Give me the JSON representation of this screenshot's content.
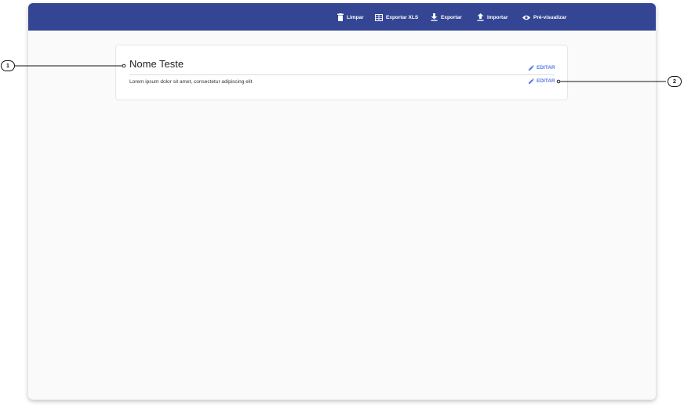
{
  "toolbar": {
    "buttons": [
      {
        "label": "Limpar",
        "icon": "trash-icon"
      },
      {
        "label": "Exportar XLS",
        "icon": "excel-icon"
      },
      {
        "label": "Exportar",
        "icon": "download-icon"
      },
      {
        "label": "Importar",
        "icon": "upload-icon"
      },
      {
        "label": "Pré-visualizar",
        "icon": "eye-icon"
      }
    ],
    "background": "#334593"
  },
  "card": {
    "title": "Nome Teste",
    "description": "Lorem ipsum dolor sit amet, consectetur adipiscing elit",
    "edit_label": "EDITAR",
    "accent": "#5a7be8"
  },
  "callouts": [
    "1",
    "2"
  ]
}
